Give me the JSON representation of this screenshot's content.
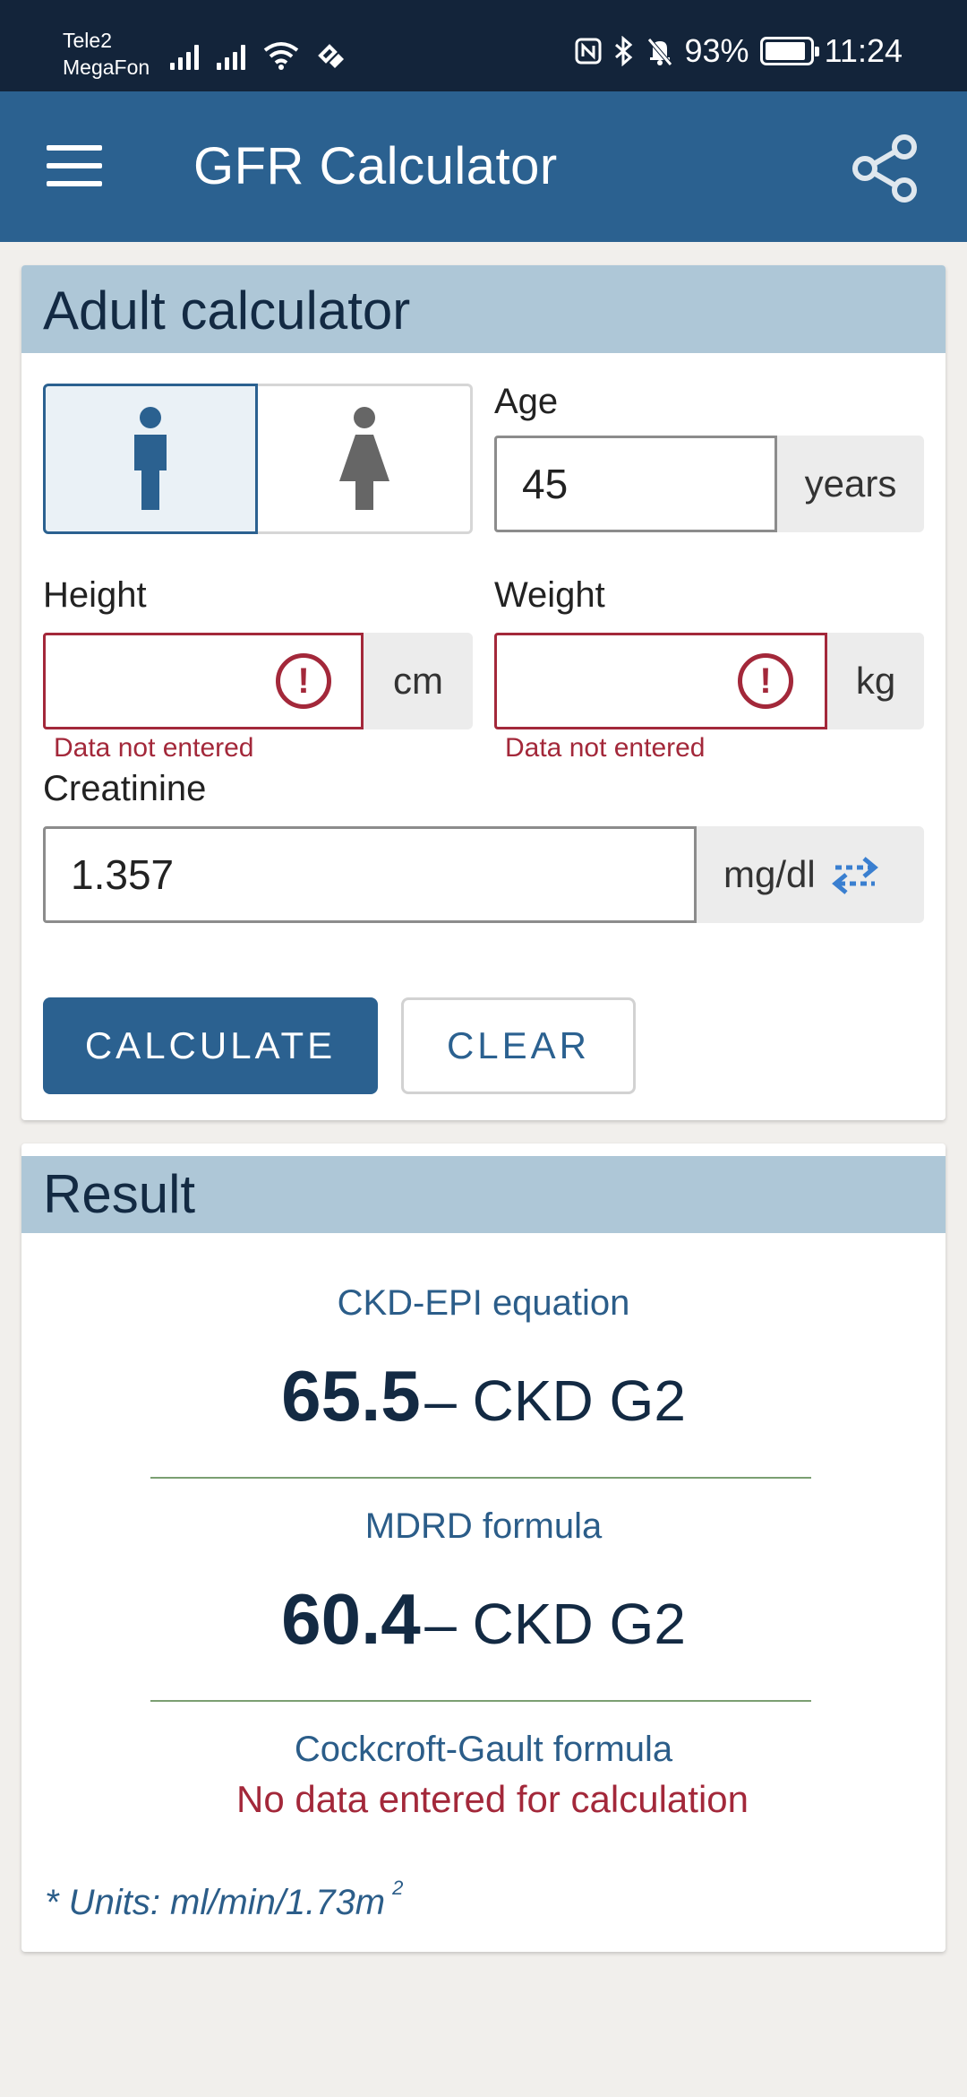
{
  "status_bar": {
    "carrier_1": "Tele2",
    "carrier_2": "MegaFon",
    "battery_percent": "93%",
    "battery_level": 0.93,
    "time": "11:24"
  },
  "app_bar": {
    "title": "GFR Calculator",
    "menu_icon": "hamburger-menu-icon",
    "share_icon": "share-icon"
  },
  "adult_calculator": {
    "title": "Adult calculator",
    "sex": {
      "options": [
        "male",
        "female"
      ],
      "selected": "male"
    },
    "age": {
      "label": "Age",
      "value": "45",
      "unit": "years"
    },
    "height": {
      "label": "Height",
      "value": "",
      "unit": "cm",
      "error": "Data not entered"
    },
    "weight": {
      "label": "Weight",
      "value": "",
      "unit": "kg",
      "error": "Data not entered"
    },
    "creatinine": {
      "label": "Creatinine",
      "value": "1.357",
      "unit": "mg/dl",
      "swap_icon": "swap-units-icon"
    },
    "calculate_label": "CALCULATE",
    "clear_label": "CLEAR"
  },
  "result": {
    "title": "Result",
    "ckd_epi": {
      "label": "CKD-EPI equation",
      "value": "65.5",
      "stage": "– CKD G2"
    },
    "mdrd": {
      "label": "MDRD formula",
      "value": "60.4",
      "stage": "– CKD G2"
    },
    "cockcroft": {
      "label": "Cockcroft-Gault formula",
      "message": "No data entered for calculation"
    },
    "units_note": "* Units: ml/min/1.73m",
    "units_sup": "2"
  },
  "colors": {
    "primary": "#2b6190",
    "status_bar": "#13243a",
    "header_band": "#aec7d7",
    "error": "#a3283a"
  }
}
